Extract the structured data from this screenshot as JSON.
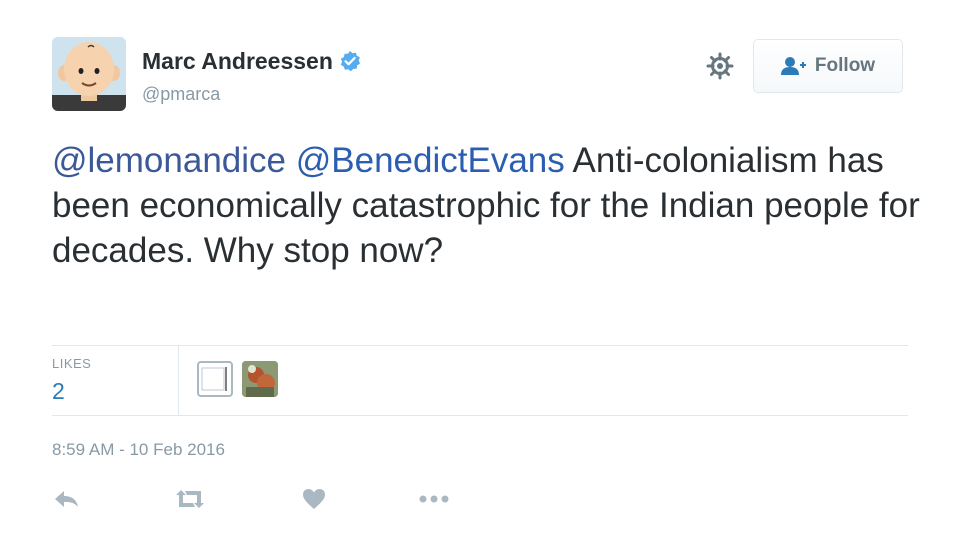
{
  "user": {
    "name": "Marc Andreessen",
    "handle": "@pmarca",
    "verified": true,
    "avatar_icon": "cartoon-avatar"
  },
  "header": {
    "settings_icon": "gear-icon",
    "follow_label": "Follow",
    "follow_icon": "add-user-icon"
  },
  "tweet": {
    "mention_1": "@lemonandice",
    "mention_2": "@BenedictEvans",
    "body": " Anti-colonialism has been economically catastrophic for the Indian people for decades. Why stop now?"
  },
  "stats": {
    "likes_label": "LIKES",
    "likes_count": "2"
  },
  "timestamp": "8:59 AM - 10 Feb 2016",
  "actions": {
    "reply_icon": "reply-icon",
    "retweet_icon": "retweet-icon",
    "like_icon": "heart-icon",
    "more_icon": "more-icon"
  },
  "colors": {
    "verified_badge": "#55acee",
    "link": "#2b5db0",
    "likes_count": "#2b7bb9",
    "muted": "#8899a6"
  }
}
